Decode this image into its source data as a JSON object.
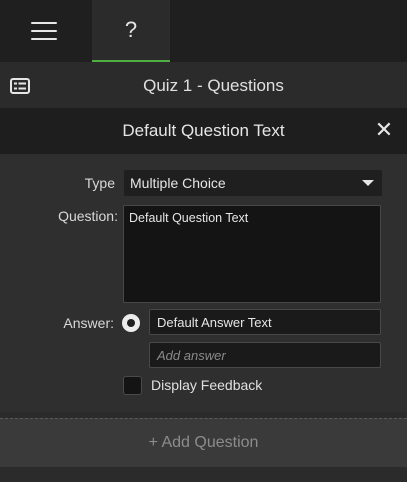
{
  "tabs": {
    "menu": "menu-icon",
    "help_label": "?"
  },
  "quiz": {
    "title": "Quiz 1 - Questions",
    "icon": "quiz-list-icon"
  },
  "question_panel": {
    "title": "Default Question Text",
    "close_label": "✕"
  },
  "form": {
    "type_label": "Type",
    "type_value": "Multiple Choice",
    "question_label": "Question:",
    "question_text": "Default Question Text",
    "answer_label": "Answer:",
    "answer_value": "Default Answer Text",
    "add_answer_placeholder": "Add answer",
    "feedback_label": "Display Feedback"
  },
  "add_question_label": "+ Add Question",
  "colors": {
    "accent": "#4caf3f",
    "background": "#2b2b2b",
    "panel": "#1e1e1e"
  }
}
